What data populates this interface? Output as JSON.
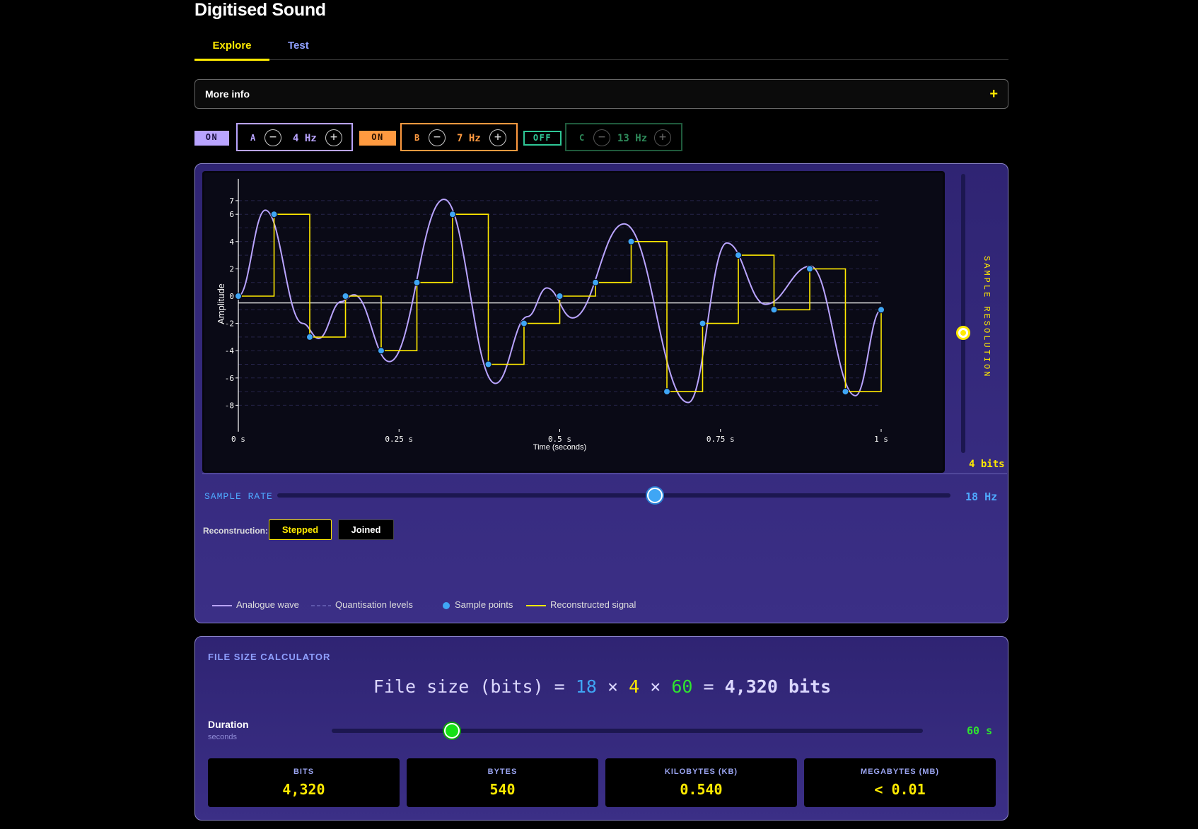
{
  "page": {
    "title": "Digitised Sound"
  },
  "tabs": [
    {
      "label": "Explore",
      "active": true
    },
    {
      "label": "Test",
      "active": false
    }
  ],
  "more_info": {
    "label": "More info",
    "icon": "+"
  },
  "waves": [
    {
      "toggle": "ON",
      "name": "A",
      "freq": "4 Hz",
      "enabled": true,
      "color": "#b9a4ff"
    },
    {
      "toggle": "ON",
      "name": "B",
      "freq": "7 Hz",
      "enabled": true,
      "color": "#ff9a40"
    },
    {
      "toggle": "OFF",
      "name": "C",
      "freq": "13 Hz",
      "enabled": false,
      "color": "#2e8a5a"
    }
  ],
  "controls": {
    "minus_icon": "−",
    "plus_icon": "+",
    "sample_resolution_label": "SAMPLE RESOLUTION",
    "sample_resolution_value": "4 bits",
    "sample_rate_label": "SAMPLE RATE",
    "sample_rate_value": "18 Hz",
    "reconstruction_label": "Reconstruction:",
    "reconstruction_options": [
      "Stepped",
      "Joined"
    ],
    "reconstruction_selected": "Stepped"
  },
  "legend": [
    {
      "label": "Analogue wave",
      "style": "line",
      "color": "#b9a4ff"
    },
    {
      "label": "Quantisation levels",
      "style": "dashed",
      "color": "#6a65b8"
    },
    {
      "label": "Sample points",
      "style": "dot",
      "color": "#3fa6f5"
    },
    {
      "label": "Reconstructed signal",
      "style": "line",
      "color": "#ffea00"
    }
  ],
  "chart_data": {
    "type": "line",
    "xlabel": "Time (seconds)",
    "ylabel": "Amplitude",
    "x_ticks": [
      "0 s",
      "0.25 s",
      "0.5 s",
      "0.75 s",
      "1 s"
    ],
    "y_ticks": [
      7,
      6,
      4,
      2,
      0,
      -2,
      -4,
      -6,
      -8
    ],
    "xlim": [
      0,
      1
    ],
    "ylim": [
      -8,
      7
    ],
    "quantisation_levels": [
      7,
      6,
      5,
      4,
      3,
      2,
      1,
      0,
      -1,
      -2,
      -3,
      -4,
      -5,
      -6,
      -7,
      -8
    ],
    "series": [
      {
        "name": "Analogue wave",
        "x": [
          0,
          0.042,
          0.1,
          0.125,
          0.16,
          0.18,
          0.235,
          0.32,
          0.4,
          0.45,
          0.48,
          0.52,
          0.6,
          0.7,
          0.76,
          0.82,
          0.89,
          0.96,
          1.0
        ],
        "y": [
          0,
          6.3,
          -2,
          -3.1,
          -0.4,
          0.1,
          -4.8,
          7.1,
          -6.4,
          -1.5,
          0.6,
          -1.6,
          5.3,
          -7.8,
          3.9,
          -0.6,
          2.2,
          -7.3,
          -1
        ]
      },
      {
        "name": "Sample points",
        "x": [
          0,
          0.0556,
          0.1111,
          0.1667,
          0.2222,
          0.2778,
          0.3333,
          0.3889,
          0.4444,
          0.5,
          0.5556,
          0.6111,
          0.6667,
          0.7222,
          0.7778,
          0.8333,
          0.8889,
          0.9444,
          1.0
        ],
        "y": [
          0,
          6,
          -3,
          0,
          -4,
          1,
          6,
          -5,
          -2,
          0,
          1,
          4,
          -7,
          -2,
          3,
          -1,
          2,
          -7,
          -1
        ]
      }
    ],
    "reconstruction": "stepped"
  },
  "calculator": {
    "title": "FILE SIZE CALCULATOR",
    "formula_lhs": "File size (bits) =",
    "rate": "18",
    "bits": "4",
    "duration": "60",
    "times": "×",
    "equals": "=",
    "result": "4,320 bits",
    "duration_label": "Duration",
    "duration_sub": "seconds",
    "duration_value": "60 s",
    "cards": [
      {
        "title": "BITS",
        "value": "4,320"
      },
      {
        "title": "BYTES",
        "value": "540"
      },
      {
        "title": "KILOBYTES (KB)",
        "value": "0.540"
      },
      {
        "title": "MEGABYTES (MB)",
        "value": "< 0.01"
      }
    ]
  },
  "colors": {
    "accent": "#ffea00",
    "rate": "#3fa6f5",
    "duration": "#2fe52f",
    "panel": "#2f2473"
  }
}
